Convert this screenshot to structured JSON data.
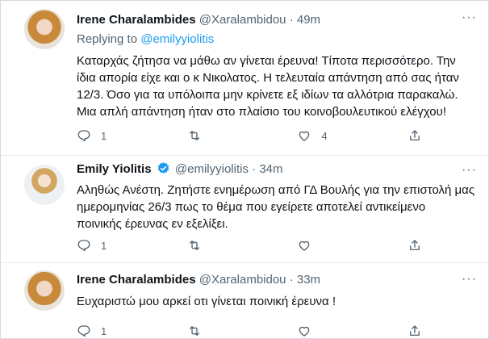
{
  "tweets": [
    {
      "name": "Irene Charalambides",
      "handle": "@Xaralambidou",
      "dot": "·",
      "time": "49m",
      "replying_prefix": "Replying to",
      "replying_to": "@emilyyiolitis",
      "lines": [
        "Καταρχάς ζήτησα να μάθω αν γίνεται έρευνα! Τίποτα περισσότερο. Την",
        "ίδια απορία είχε και ο κ Νικολατος. Η τελευταία απάντηση από σας ήταν",
        "12/3. Όσο για τα υπόλοιπα μην κρίνετε εξ ιδίων τα αλλότρια παρακαλώ.",
        "Μια απλή απάντηση ήταν στο πλαίσιο του κοινοβουλευτικού ελέγχου!"
      ],
      "actions": {
        "reply": "1",
        "retweet": "",
        "like": "4",
        "share": ""
      }
    },
    {
      "name": "Emily Yiolitis",
      "handle": "@emilyyiolitis",
      "dot": "·",
      "time": "34m",
      "verified": true,
      "lines": [
        "Αληθώς Ανέστη. Ζητήστε ενημέρωση από ΓΔ Βουλής για την επιστολή μας",
        "ημερομηνίας 26/3 πως το θέμα που εγείρετε αποτελεί αντικείμενο",
        "ποινικής έρευνας εν εξελίξει."
      ],
      "actions": {
        "reply": "1",
        "retweet": "",
        "like": "",
        "share": ""
      }
    },
    {
      "name": "Irene Charalambides",
      "handle": "@Xaralambidou",
      "dot": "·",
      "time": "33m",
      "lines": [
        "Ευχαριστώ μου αρκεί οτι γίνεται ποινική έρευνα !"
      ],
      "actions": {
        "reply": "1",
        "retweet": "",
        "like": "",
        "share": ""
      }
    }
  ],
  "icons": {
    "more": "more-icon",
    "reply": "reply-icon",
    "retweet": "retweet-icon",
    "like": "like-icon",
    "share": "share-icon",
    "verified": "verified-badge-icon"
  },
  "colors": {
    "text": "#0f1419",
    "secondary": "#536471",
    "link": "#1d9bf0",
    "verified": "#1d9bf0",
    "divider": "#e6ecf0"
  }
}
